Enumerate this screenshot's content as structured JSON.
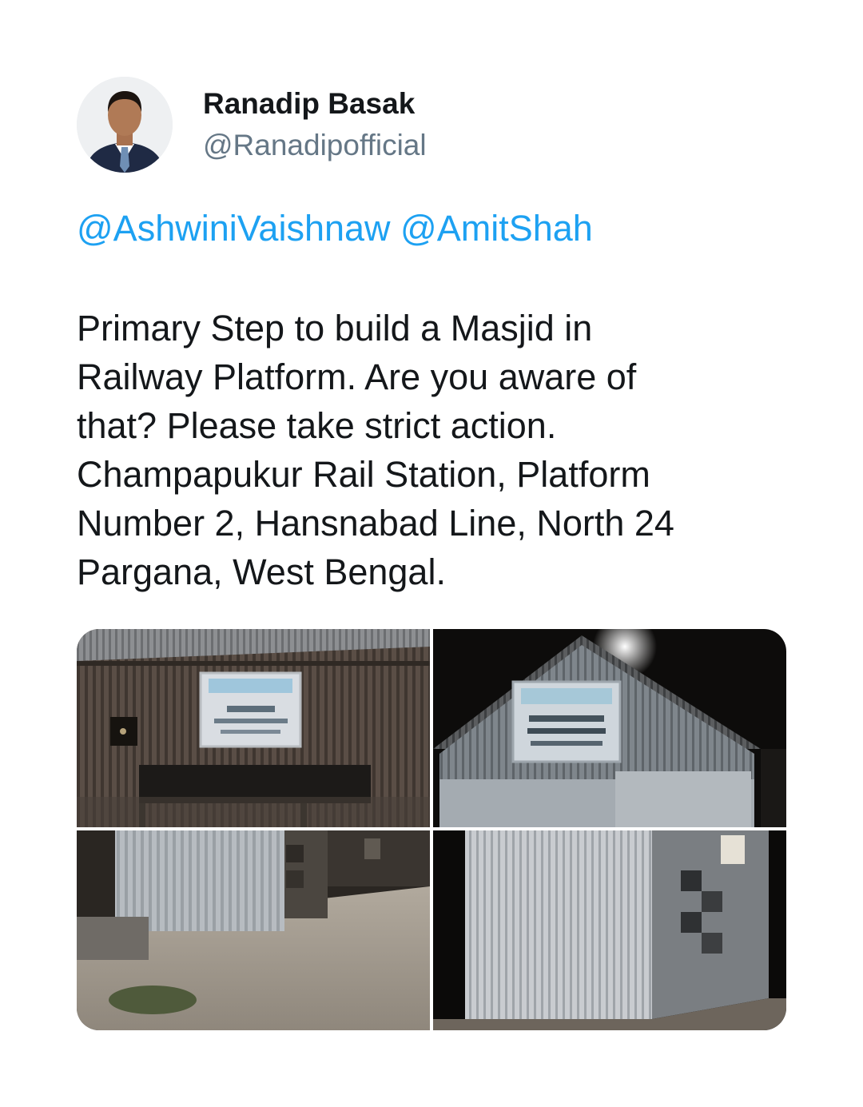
{
  "user": {
    "display_name": "Ranadip Basak",
    "handle": "@Ranadipofficial",
    "avatar_icon": "profile-photo"
  },
  "tweet": {
    "mentions": [
      "@AshwiniVaishnaw",
      "@AmitShah"
    ],
    "body_lines": [
      "Primary Step to build a Masjid in",
      "Railway Platform. Are you aware of",
      "that? Please take strict action.",
      "Champapukur Rail Station, Platform",
      "Number 2, Hansnabad Line, North 24",
      "Pargana, West Bengal."
    ]
  },
  "media": {
    "count": 4,
    "photos": [
      {
        "name": "photo-shed-front-signboard"
      },
      {
        "name": "photo-shed-night-roof"
      },
      {
        "name": "photo-shed-platform-side"
      },
      {
        "name": "photo-shed-corner-night"
      }
    ]
  },
  "colors": {
    "link": "#1da1f2",
    "text": "#14171a",
    "secondary": "#657786",
    "background": "#ffffff"
  }
}
